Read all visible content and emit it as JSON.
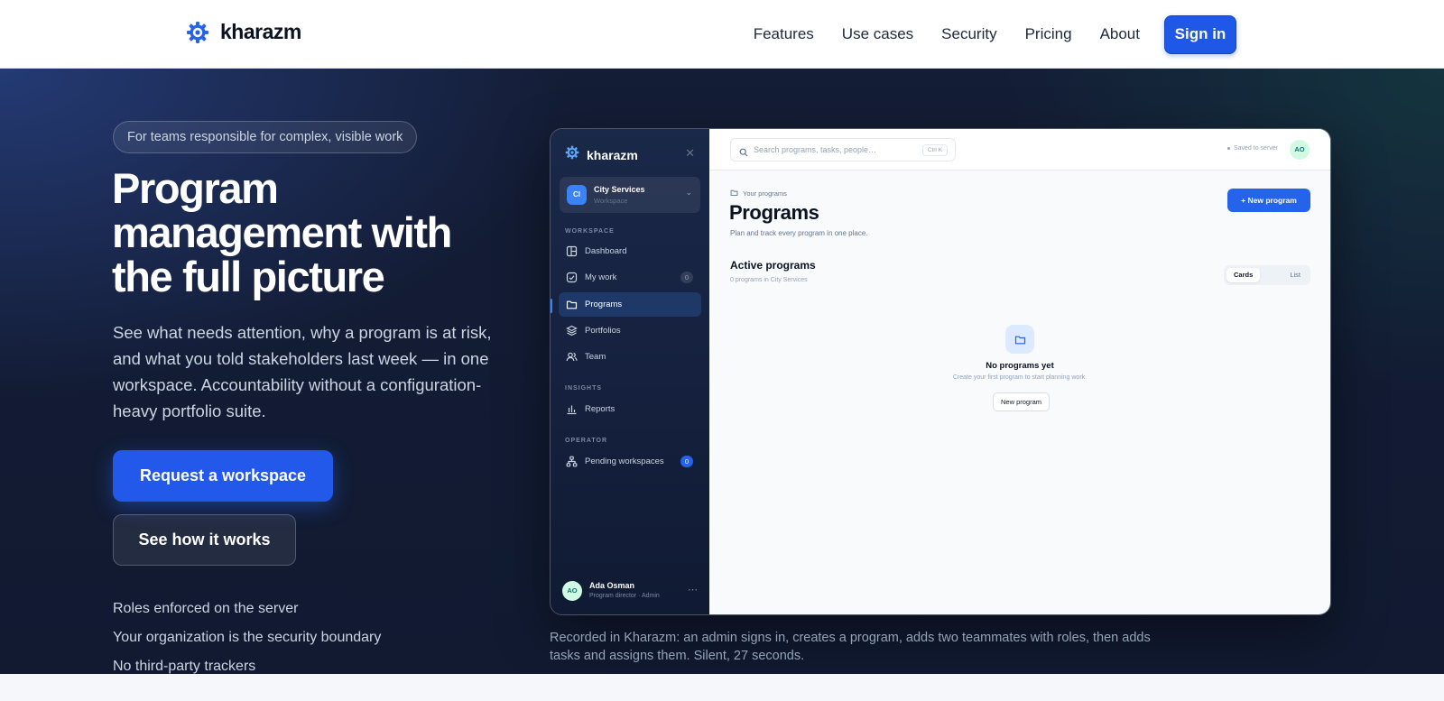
{
  "brand": {
    "name": "kharazm"
  },
  "nav": {
    "links": [
      "Features",
      "Use cases",
      "Security",
      "Pricing",
      "About"
    ],
    "signin_label": "Sign in"
  },
  "hero": {
    "pill": "For teams responsible for complex, visible work",
    "title": "Program management with the full picture",
    "subtitle": "See what needs attention, why a program is at risk, and what you told stakeholders last week — in one workspace. Accountability without a configuration-heavy portfolio suite.",
    "primary_cta": "Request a workspace",
    "secondary_cta": "See how it works",
    "points": [
      "Roles enforced on the server",
      "Your organization is the security boundary",
      "No third-party trackers"
    ],
    "caption": "Recorded in Kharazm: an admin signs in, creates a program, adds two teammates with roles, then adds tasks and assigns them. Silent, 27 seconds."
  },
  "app": {
    "brand": "kharazm",
    "close_glyph": "✕",
    "workspace": {
      "initials": "CI",
      "name": "City Services",
      "type": "Workspace"
    },
    "sections": {
      "workspace": "WORKSPACE",
      "insights": "INSIGHTS",
      "operator": "OPERATOR"
    },
    "nav": {
      "dashboard": "Dashboard",
      "my_work": "My work",
      "my_work_count": "0",
      "programs": "Programs",
      "portfolios": "Portfolios",
      "team": "Team",
      "reports": "Reports",
      "pending": "Pending workspaces",
      "pending_count": "0"
    },
    "user": {
      "initials": "AO",
      "name": "Ada Osman",
      "role": "Program director · Admin"
    },
    "search": {
      "placeholder": "Search programs, tasks, people…",
      "shortcut": "Ctrl K"
    },
    "saved": "Saved to server",
    "top_avatar": "AO",
    "breadcrumb": "Your programs",
    "page_title": "Programs",
    "page_sub": "Plan and track every program in one place.",
    "new_program": "+ New program",
    "section_title": "Active programs",
    "section_sub": "0 programs in City Services",
    "view_cards": "Cards",
    "view_list": "List",
    "empty": {
      "title": "No programs yet",
      "sub": "Create your first program to start planning work.",
      "button": "New program"
    }
  },
  "colors": {
    "accent": "#2563eb",
    "hero_bg": "#141d36"
  }
}
